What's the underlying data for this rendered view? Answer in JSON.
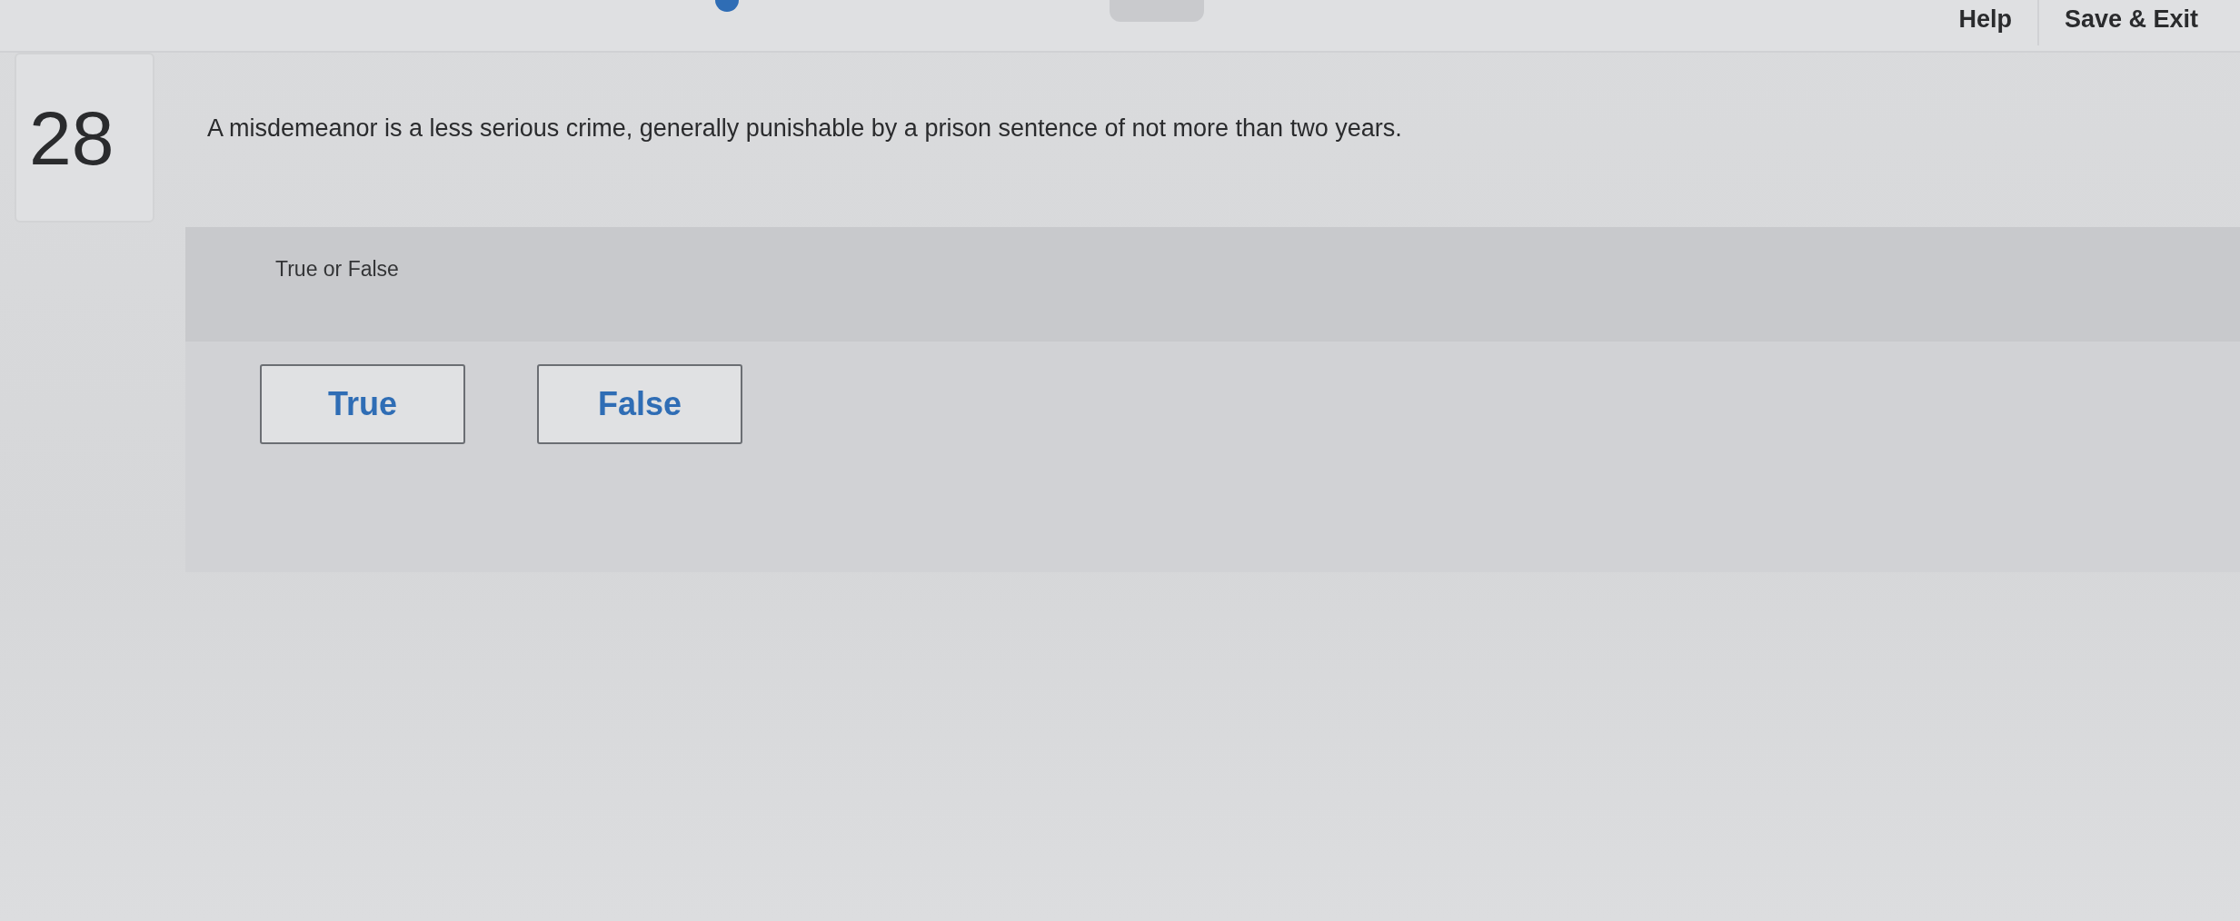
{
  "header": {
    "links": [
      {
        "label": "Help"
      },
      {
        "label": "Save & Exit"
      }
    ]
  },
  "question": {
    "number": "28",
    "prompt": "A misdemeanor is a less serious crime, generally punishable by a prison sentence of not more than two years.",
    "type_label": "True or False",
    "choices": [
      {
        "label": "True",
        "selected": false
      },
      {
        "label": "False",
        "selected": false
      }
    ]
  }
}
